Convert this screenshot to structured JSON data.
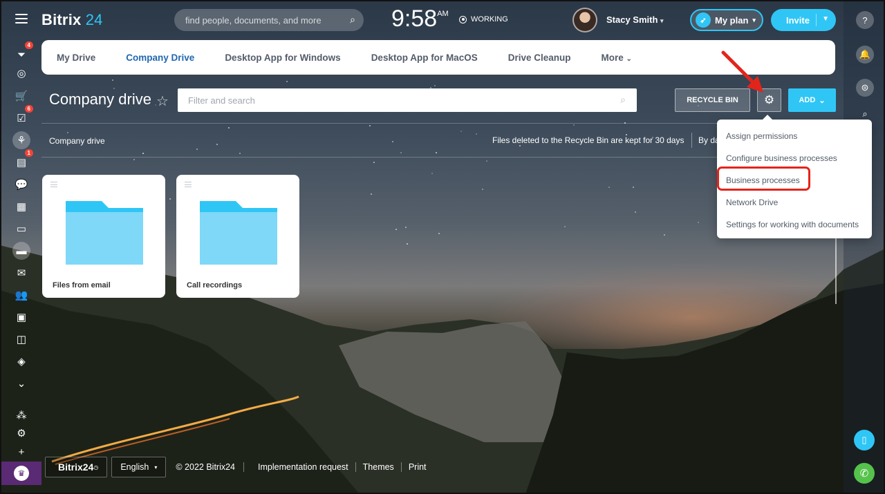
{
  "header": {
    "logo_text": "Bitrix",
    "logo_num": "24",
    "search_placeholder": "find people, documents, and more",
    "clock": "9:58",
    "clock_ampm": "AM",
    "work_status": "WORKING",
    "user_name": "Stacy Smith",
    "myplan_label": "My plan",
    "invite_label": "Invite"
  },
  "sidebar": {
    "badges": {
      "feed": "4",
      "tasks": "6",
      "chat": "1"
    }
  },
  "tabs": [
    {
      "label": "My Drive"
    },
    {
      "label": "Company Drive"
    },
    {
      "label": "Desktop App for Windows"
    },
    {
      "label": "Desktop App for MacOS"
    },
    {
      "label": "Drive Cleanup"
    },
    {
      "label": "More"
    }
  ],
  "toolbar": {
    "title": "Company drive",
    "filter_placeholder": "Filter and search",
    "recycle_label": "RECYCLE BIN",
    "add_label": "ADD"
  },
  "breadcrumb": {
    "path": "Company drive",
    "recycle_note": "Files deleted to the Recycle Bin are kept for 30 days",
    "sort_label": "By da"
  },
  "folders": [
    {
      "name": "Files from email"
    },
    {
      "name": "Call recordings"
    }
  ],
  "settings_menu": [
    {
      "label": "Assign permissions"
    },
    {
      "label": "Configure business processes"
    },
    {
      "label": "Business processes"
    },
    {
      "label": "Network Drive"
    },
    {
      "label": "Settings for working with documents"
    }
  ],
  "footer": {
    "logo": "Bitrix24",
    "language": "English",
    "copyright": "© 2022 Bitrix24",
    "links": [
      "Implementation request",
      "Themes",
      "Print"
    ]
  },
  "colors": {
    "accent": "#2fc6f6",
    "active_tab": "#2067b0",
    "highlight": "#e3241b"
  }
}
